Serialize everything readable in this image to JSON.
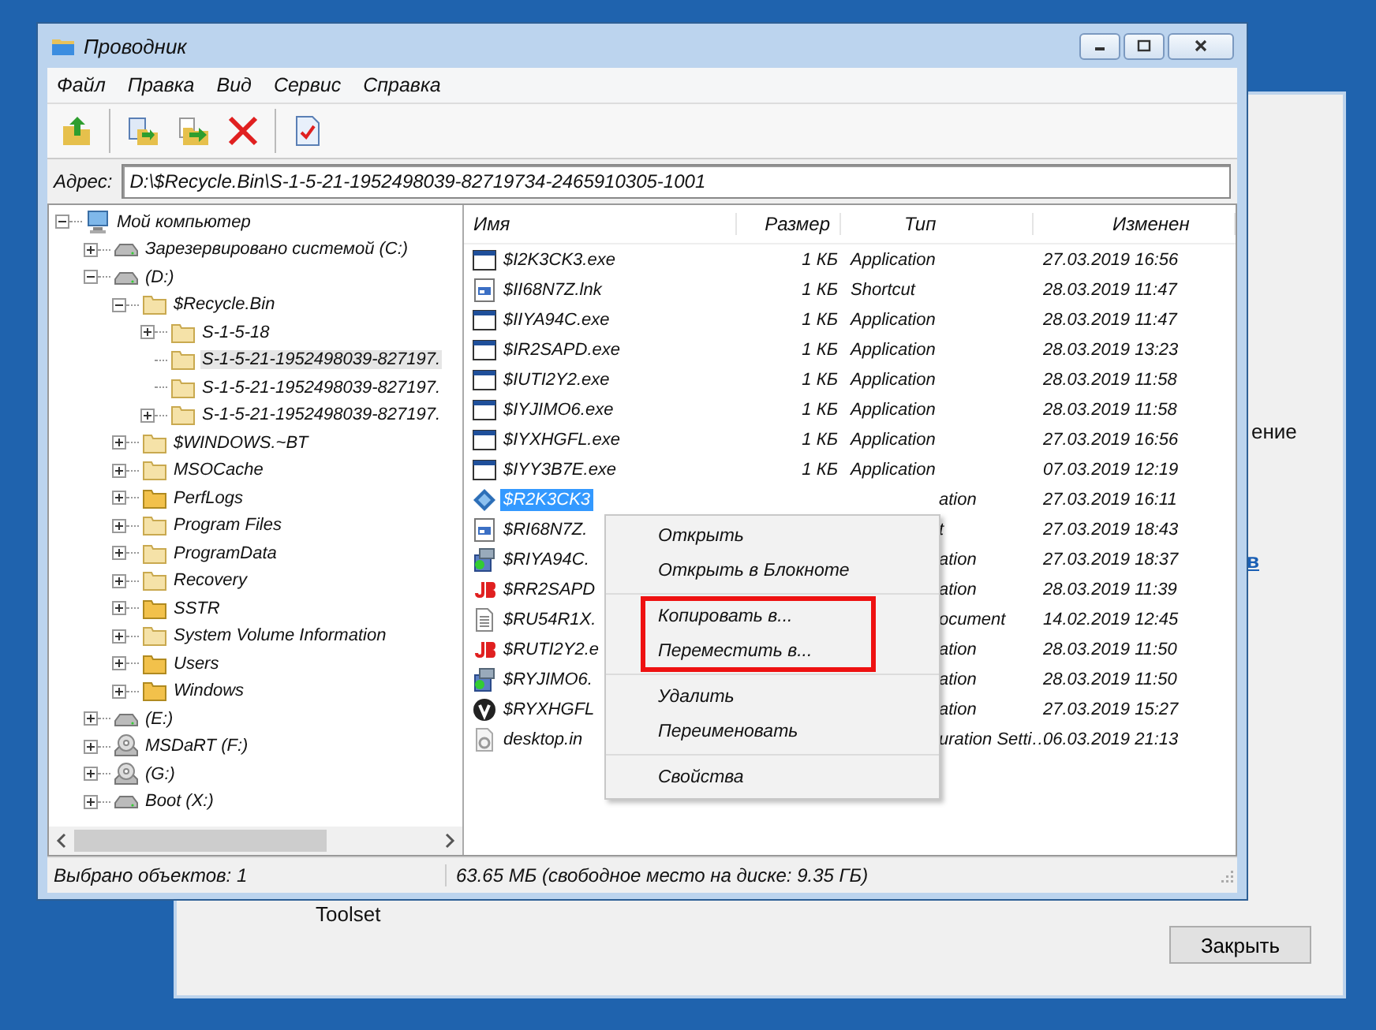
{
  "background_window": {
    "fragment_text": "ение",
    "link": "в",
    "label": "Toolset",
    "close_button": "Закрыть"
  },
  "window": {
    "title": "Проводник"
  },
  "menu_bar": [
    "Файл",
    "Правка",
    "Вид",
    "Сервис",
    "Справка"
  ],
  "address": {
    "label": "Адрес:",
    "value": "D:\\$Recycle.Bin\\S-1-5-21-1952498039-82719734-2465910305-1001"
  },
  "tree": [
    {
      "label": "Мой компьютер",
      "kind": "computer",
      "expandable": true,
      "expanded": true,
      "selected": false,
      "children": [
        {
          "label": "Зарезервировано системой (C:)",
          "kind": "drive",
          "expandable": true,
          "expanded": false,
          "selected": false
        },
        {
          "label": "(D:)",
          "kind": "drive",
          "expandable": true,
          "expanded": true,
          "selected": false,
          "children": [
            {
              "label": "$Recycle.Bin",
              "kind": "folder-light",
              "expandable": true,
              "expanded": true,
              "selected": false,
              "children": [
                {
                  "label": "S-1-5-18",
                  "kind": "folder-light",
                  "expandable": true,
                  "expanded": false,
                  "selected": false
                },
                {
                  "label": "S-1-5-21-1952498039-827197.",
                  "kind": "folder-light",
                  "expandable": false,
                  "expanded": false,
                  "selected": true
                },
                {
                  "label": "S-1-5-21-1952498039-827197.",
                  "kind": "folder-light",
                  "expandable": false,
                  "expanded": false,
                  "selected": false
                },
                {
                  "label": "S-1-5-21-1952498039-827197.",
                  "kind": "folder-light",
                  "expandable": true,
                  "expanded": false,
                  "selected": false
                }
              ]
            },
            {
              "label": "$WINDOWS.~BT",
              "kind": "folder-light",
              "expandable": true,
              "expanded": false,
              "selected": false
            },
            {
              "label": "MSOCache",
              "kind": "folder-light",
              "expandable": true,
              "expanded": false,
              "selected": false
            },
            {
              "label": "PerfLogs",
              "kind": "folder-dark",
              "expandable": true,
              "expanded": false,
              "selected": false
            },
            {
              "label": "Program Files",
              "kind": "folder-light",
              "expandable": true,
              "expanded": false,
              "selected": false
            },
            {
              "label": "ProgramData",
              "kind": "folder-light",
              "expandable": true,
              "expanded": false,
              "selected": false
            },
            {
              "label": "Recovery",
              "kind": "folder-light",
              "expandable": true,
              "expanded": false,
              "selected": false
            },
            {
              "label": "SSTR",
              "kind": "folder-dark",
              "expandable": true,
              "expanded": false,
              "selected": false
            },
            {
              "label": "System Volume Information",
              "kind": "folder-light",
              "expandable": true,
              "expanded": false,
              "selected": false
            },
            {
              "label": "Users",
              "kind": "folder-dark",
              "expandable": true,
              "expanded": false,
              "selected": false
            },
            {
              "label": "Windows",
              "kind": "folder-dark",
              "expandable": true,
              "expanded": false,
              "selected": false
            }
          ]
        },
        {
          "label": "(E:)",
          "kind": "drive",
          "expandable": true,
          "expanded": false,
          "selected": false
        },
        {
          "label": "MSDaRT (F:)",
          "kind": "disc",
          "expandable": true,
          "expanded": false,
          "selected": false
        },
        {
          "label": "(G:)",
          "kind": "disc",
          "expandable": true,
          "expanded": false,
          "selected": false
        },
        {
          "label": "Boot (X:)",
          "kind": "drive",
          "expandable": true,
          "expanded": false,
          "selected": false
        }
      ]
    }
  ],
  "table": {
    "columns": [
      "Имя",
      "Размер",
      "Тип",
      "Изменен"
    ],
    "rows": [
      {
        "name": "$I2K3CK3.exe",
        "size": "1 КБ",
        "type": "Application",
        "modified": "27.03.2019 16:56",
        "kind": "app",
        "selected": false,
        "covered": false
      },
      {
        "name": "$II68N7Z.lnk",
        "size": "1 КБ",
        "type": "Shortcut",
        "modified": "28.03.2019 11:47",
        "kind": "shortcut",
        "selected": false,
        "covered": false
      },
      {
        "name": "$IIYA94C.exe",
        "size": "1 КБ",
        "type": "Application",
        "modified": "28.03.2019 11:47",
        "kind": "app",
        "selected": false,
        "covered": false
      },
      {
        "name": "$IR2SAPD.exe",
        "size": "1 КБ",
        "type": "Application",
        "modified": "28.03.2019 13:23",
        "kind": "app",
        "selected": false,
        "covered": false
      },
      {
        "name": "$IUTI2Y2.exe",
        "size": "1 КБ",
        "type": "Application",
        "modified": "28.03.2019 11:58",
        "kind": "app",
        "selected": false,
        "covered": false
      },
      {
        "name": "$IYJIMO6.exe",
        "size": "1 КБ",
        "type": "Application",
        "modified": "28.03.2019 11:58",
        "kind": "app",
        "selected": false,
        "covered": false
      },
      {
        "name": "$IYXHGFL.exe",
        "size": "1 КБ",
        "type": "Application",
        "modified": "27.03.2019 16:56",
        "kind": "app",
        "selected": false,
        "covered": false
      },
      {
        "name": "$IYY3B7E.exe",
        "size": "1 КБ",
        "type": "Application",
        "modified": "07.03.2019 12:19",
        "kind": "app",
        "selected": false,
        "covered": false
      },
      {
        "name": "$R2K3CK3",
        "type": "ation",
        "modified": "27.03.2019 16:11",
        "kind": "diamond",
        "selected": true,
        "covered": true
      },
      {
        "name": "$RI68N7Z.",
        "type": "t",
        "modified": "27.03.2019 18:43",
        "kind": "shortcut",
        "selected": false,
        "covered": true
      },
      {
        "name": "$RIYA94C.",
        "type": "ation",
        "modified": "27.03.2019 18:37",
        "kind": "installer",
        "selected": false,
        "covered": true
      },
      {
        "name": "$RR2SAPD",
        "type": "ation",
        "modified": "28.03.2019 11:39",
        "kind": "letter-logo",
        "selected": false,
        "covered": true
      },
      {
        "name": "$RU54R1X.",
        "type": "ocument",
        "modified": "14.02.2019 12:45",
        "kind": "document",
        "selected": false,
        "covered": true
      },
      {
        "name": "$RUTI2Y2.e",
        "type": "ation",
        "modified": "28.03.2019 11:50",
        "kind": "letter-logo",
        "selected": false,
        "covered": true
      },
      {
        "name": "$RYJIMO6.",
        "type": "ation",
        "modified": "28.03.2019 11:50",
        "kind": "installer",
        "selected": false,
        "covered": true
      },
      {
        "name": "$RYXHGFL",
        "type": "ation",
        "modified": "27.03.2019 15:27",
        "kind": "round-logo",
        "selected": false,
        "covered": true
      },
      {
        "name": "desktop.in",
        "type": "uration Setti…",
        "modified": "06.03.2019 21:13",
        "kind": "settings-file",
        "selected": false,
        "covered": true
      }
    ]
  },
  "context_menu": [
    {
      "items": [
        "Открыть",
        "Открыть в Блокноте"
      ],
      "annotated": false
    },
    {
      "items": [
        "Копировать в...",
        "Переместить в..."
      ],
      "annotated": true
    },
    {
      "items": [
        "Удалить",
        "Переименовать"
      ],
      "annotated": false
    },
    {
      "items": [
        "Свойства"
      ],
      "annotated": false
    }
  ],
  "status_bar": [
    "Выбрано объектов: 1",
    "63.65 МБ (свободное место на диске: 9.35 ГБ)"
  ]
}
